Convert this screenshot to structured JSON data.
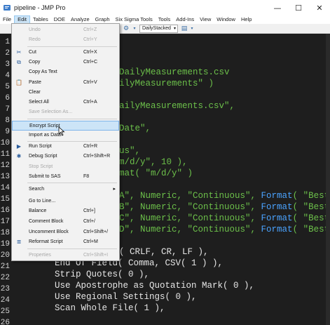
{
  "window": {
    "title": "pipeline - JMP Pro",
    "controls": {
      "minimize": "—",
      "maximize": "☐",
      "close": "✕"
    }
  },
  "menubar": [
    "File",
    "Edit",
    "Tables",
    "DOE",
    "Analyze",
    "Graph",
    "Six Sigma Tools",
    "Tools",
    "Add-Ins",
    "View",
    "Window",
    "Help"
  ],
  "toolbar": {
    "dropdown_value": "DailyStacked"
  },
  "edit_menu": [
    {
      "label": "Undo",
      "shortcut": "Ctrl+Z",
      "disabled": true,
      "icon": ""
    },
    {
      "label": "Redo",
      "shortcut": "Ctrl+Y",
      "disabled": true,
      "icon": ""
    },
    {
      "label": "Cut",
      "shortcut": "Ctrl+X",
      "disabled": false,
      "icon": "scissors-icon"
    },
    {
      "label": "Copy",
      "shortcut": "Ctrl+C",
      "disabled": false,
      "icon": "copy-icon"
    },
    {
      "label": "Copy As Text",
      "shortcut": "",
      "disabled": false,
      "icon": ""
    },
    {
      "label": "Paste",
      "shortcut": "Ctrl+V",
      "disabled": false,
      "icon": "paste-icon"
    },
    {
      "label": "Clear",
      "shortcut": "",
      "disabled": false,
      "icon": ""
    },
    {
      "label": "Select All",
      "shortcut": "Ctrl+A",
      "disabled": false,
      "icon": ""
    },
    {
      "label": "Save Selection As...",
      "shortcut": "",
      "disabled": true,
      "icon": ""
    },
    {
      "label": "Encrypt Script",
      "shortcut": "",
      "disabled": false,
      "icon": "",
      "highlighted": true
    },
    {
      "label": "Import as Data",
      "shortcut": "",
      "disabled": false,
      "icon": ""
    },
    {
      "label": "Run Script",
      "shortcut": "Ctrl+R",
      "disabled": false,
      "icon": "run-script-icon"
    },
    {
      "label": "Debug Script",
      "shortcut": "Ctrl+Shift+R",
      "disabled": false,
      "icon": "debug-icon"
    },
    {
      "label": "Stop Script",
      "shortcut": "",
      "disabled": true,
      "icon": ""
    },
    {
      "label": "Submit to SAS",
      "shortcut": "F8",
      "disabled": false,
      "icon": ""
    },
    {
      "label": "Search",
      "shortcut": "",
      "disabled": false,
      "icon": "",
      "submenu": true
    },
    {
      "label": "Go to Line...",
      "shortcut": "",
      "disabled": false,
      "icon": ""
    },
    {
      "label": "Balance",
      "shortcut": "Ctrl+]",
      "disabled": false,
      "icon": ""
    },
    {
      "label": "Comment Block",
      "shortcut": "Ctrl+/",
      "disabled": false,
      "icon": ""
    },
    {
      "label": "Uncomment Block",
      "shortcut": "Ctrl+Shift+/",
      "disabled": false,
      "icon": ""
    },
    {
      "label": "Reformat Script",
      "shortcut": "Ctrl+M",
      "disabled": false,
      "icon": "reformat-icon"
    },
    {
      "label": "Properties",
      "shortcut": "Ctrl+Shift+I",
      "disabled": true,
      "icon": ""
    }
  ],
  "line_numbers": [
    "1",
    "2",
    "3",
    "4",
    "5",
    "6",
    "7",
    "8",
    "9",
    "10",
    "11",
    "12",
    "13",
    "14",
    "15",
    "16",
    "17",
    "18",
    "19",
    "20",
    "21",
    "22",
    "23",
    "24",
    "25",
    "26"
  ],
  "code_fragments": {
    "l4": "DailyMeasurements.csv",
    "l5": "ilyMeasurements\" )",
    "l7": "ailyMeasurements.csv\",",
    "l9": "Date\",",
    "l11": "us\",",
    "l12": "m/d/y\", 10 ),",
    "l13": "mat( \"m/d/y\" )",
    "l15": [
      "A\", Numeric, \"Continuous\", ",
      "Format",
      "( \"Best\","
    ],
    "l16": [
      "B\", Numeric, \"Continuous\", ",
      "Format",
      "( \"Best\","
    ],
    "l17": [
      "C\", Numeric, \"Continuous\", ",
      "Format",
      "( \"Best\","
    ],
    "l18": [
      "D\", Numeric, \"Continuous\", ",
      "Format",
      "( \"Best\","
    ],
    "l20": "( CRLF, CR, LF ),",
    "l21": "End Of Field( Comma, CSV( 1 ) ),",
    "l22": "Strip Quotes( 0 ),",
    "l23": "Use Apostrophe as Quotation Mark( 0 ),",
    "l24": "Use Regional Settings( 0 ),",
    "l25": "Scan Whole File( 1 ),"
  }
}
